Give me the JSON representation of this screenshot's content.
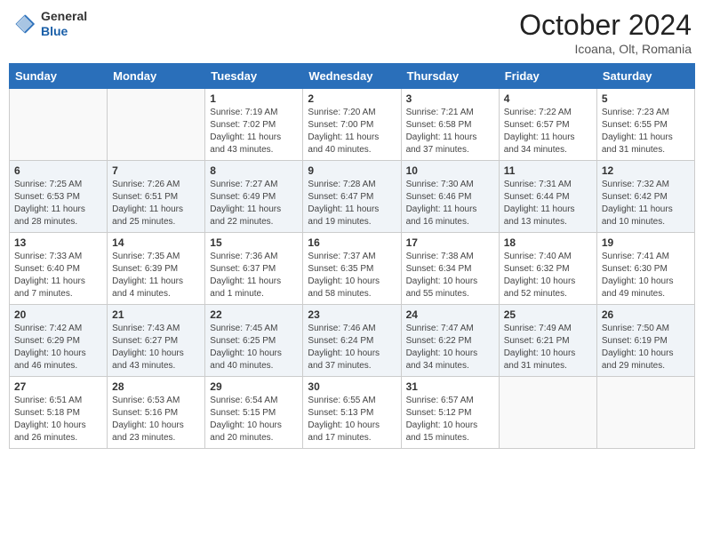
{
  "header": {
    "logo_general": "General",
    "logo_blue": "Blue",
    "month_title": "October 2024",
    "location": "Icoana, Olt, Romania"
  },
  "days_of_week": [
    "Sunday",
    "Monday",
    "Tuesday",
    "Wednesday",
    "Thursday",
    "Friday",
    "Saturday"
  ],
  "weeks": [
    [
      {
        "day": "",
        "info": ""
      },
      {
        "day": "",
        "info": ""
      },
      {
        "day": "1",
        "info": "Sunrise: 7:19 AM\nSunset: 7:02 PM\nDaylight: 11 hours and 43 minutes."
      },
      {
        "day": "2",
        "info": "Sunrise: 7:20 AM\nSunset: 7:00 PM\nDaylight: 11 hours and 40 minutes."
      },
      {
        "day": "3",
        "info": "Sunrise: 7:21 AM\nSunset: 6:58 PM\nDaylight: 11 hours and 37 minutes."
      },
      {
        "day": "4",
        "info": "Sunrise: 7:22 AM\nSunset: 6:57 PM\nDaylight: 11 hours and 34 minutes."
      },
      {
        "day": "5",
        "info": "Sunrise: 7:23 AM\nSunset: 6:55 PM\nDaylight: 11 hours and 31 minutes."
      }
    ],
    [
      {
        "day": "6",
        "info": "Sunrise: 7:25 AM\nSunset: 6:53 PM\nDaylight: 11 hours and 28 minutes."
      },
      {
        "day": "7",
        "info": "Sunrise: 7:26 AM\nSunset: 6:51 PM\nDaylight: 11 hours and 25 minutes."
      },
      {
        "day": "8",
        "info": "Sunrise: 7:27 AM\nSunset: 6:49 PM\nDaylight: 11 hours and 22 minutes."
      },
      {
        "day": "9",
        "info": "Sunrise: 7:28 AM\nSunset: 6:47 PM\nDaylight: 11 hours and 19 minutes."
      },
      {
        "day": "10",
        "info": "Sunrise: 7:30 AM\nSunset: 6:46 PM\nDaylight: 11 hours and 16 minutes."
      },
      {
        "day": "11",
        "info": "Sunrise: 7:31 AM\nSunset: 6:44 PM\nDaylight: 11 hours and 13 minutes."
      },
      {
        "day": "12",
        "info": "Sunrise: 7:32 AM\nSunset: 6:42 PM\nDaylight: 11 hours and 10 minutes."
      }
    ],
    [
      {
        "day": "13",
        "info": "Sunrise: 7:33 AM\nSunset: 6:40 PM\nDaylight: 11 hours and 7 minutes."
      },
      {
        "day": "14",
        "info": "Sunrise: 7:35 AM\nSunset: 6:39 PM\nDaylight: 11 hours and 4 minutes."
      },
      {
        "day": "15",
        "info": "Sunrise: 7:36 AM\nSunset: 6:37 PM\nDaylight: 11 hours and 1 minute."
      },
      {
        "day": "16",
        "info": "Sunrise: 7:37 AM\nSunset: 6:35 PM\nDaylight: 10 hours and 58 minutes."
      },
      {
        "day": "17",
        "info": "Sunrise: 7:38 AM\nSunset: 6:34 PM\nDaylight: 10 hours and 55 minutes."
      },
      {
        "day": "18",
        "info": "Sunrise: 7:40 AM\nSunset: 6:32 PM\nDaylight: 10 hours and 52 minutes."
      },
      {
        "day": "19",
        "info": "Sunrise: 7:41 AM\nSunset: 6:30 PM\nDaylight: 10 hours and 49 minutes."
      }
    ],
    [
      {
        "day": "20",
        "info": "Sunrise: 7:42 AM\nSunset: 6:29 PM\nDaylight: 10 hours and 46 minutes."
      },
      {
        "day": "21",
        "info": "Sunrise: 7:43 AM\nSunset: 6:27 PM\nDaylight: 10 hours and 43 minutes."
      },
      {
        "day": "22",
        "info": "Sunrise: 7:45 AM\nSunset: 6:25 PM\nDaylight: 10 hours and 40 minutes."
      },
      {
        "day": "23",
        "info": "Sunrise: 7:46 AM\nSunset: 6:24 PM\nDaylight: 10 hours and 37 minutes."
      },
      {
        "day": "24",
        "info": "Sunrise: 7:47 AM\nSunset: 6:22 PM\nDaylight: 10 hours and 34 minutes."
      },
      {
        "day": "25",
        "info": "Sunrise: 7:49 AM\nSunset: 6:21 PM\nDaylight: 10 hours and 31 minutes."
      },
      {
        "day": "26",
        "info": "Sunrise: 7:50 AM\nSunset: 6:19 PM\nDaylight: 10 hours and 29 minutes."
      }
    ],
    [
      {
        "day": "27",
        "info": "Sunrise: 6:51 AM\nSunset: 5:18 PM\nDaylight: 10 hours and 26 minutes."
      },
      {
        "day": "28",
        "info": "Sunrise: 6:53 AM\nSunset: 5:16 PM\nDaylight: 10 hours and 23 minutes."
      },
      {
        "day": "29",
        "info": "Sunrise: 6:54 AM\nSunset: 5:15 PM\nDaylight: 10 hours and 20 minutes."
      },
      {
        "day": "30",
        "info": "Sunrise: 6:55 AM\nSunset: 5:13 PM\nDaylight: 10 hours and 17 minutes."
      },
      {
        "day": "31",
        "info": "Sunrise: 6:57 AM\nSunset: 5:12 PM\nDaylight: 10 hours and 15 minutes."
      },
      {
        "day": "",
        "info": ""
      },
      {
        "day": "",
        "info": ""
      }
    ]
  ]
}
